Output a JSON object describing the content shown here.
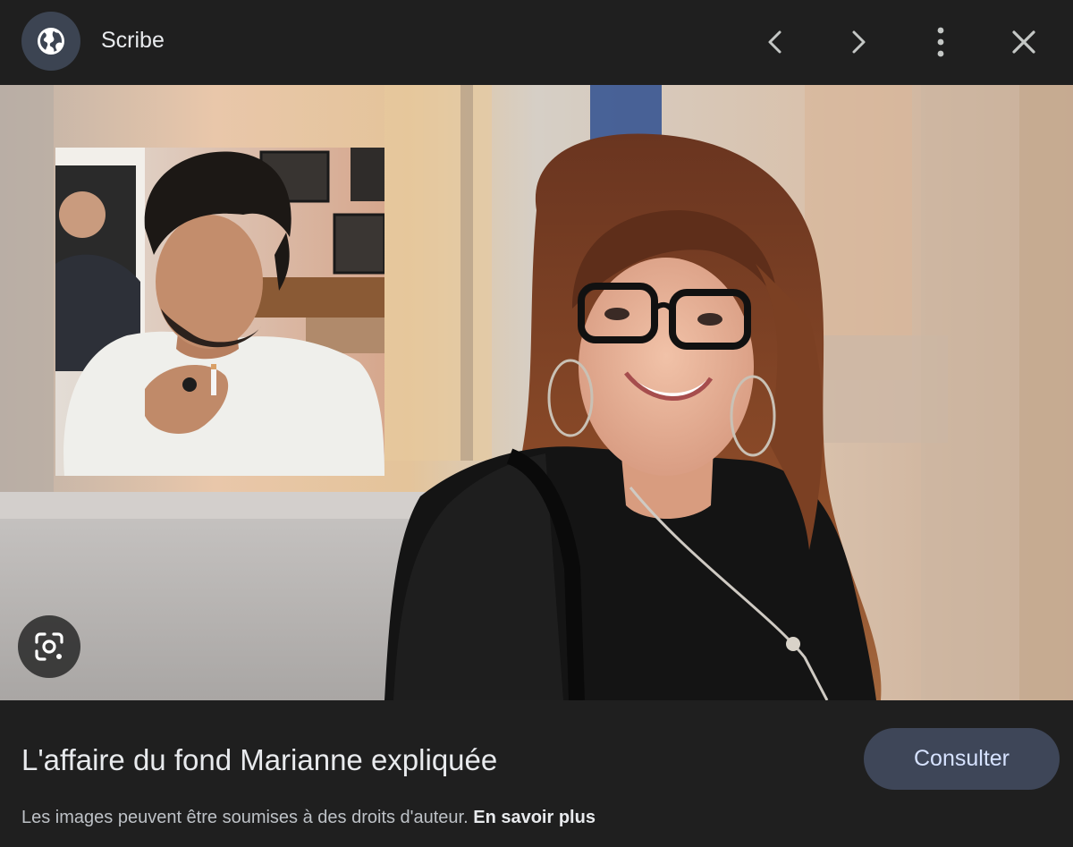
{
  "header": {
    "site_name": "Scribe",
    "site_icon": "globe-icon",
    "prev_icon": "chevron-left-icon",
    "next_icon": "chevron-right-icon",
    "more_icon": "more-vert-icon",
    "close_icon": "close-icon"
  },
  "image": {
    "lens_icon": "google-lens-icon"
  },
  "footer": {
    "title": "L'affaire du fond Marianne expliquée",
    "consult_label": "Consulter",
    "copyright_text": "Les images peuvent être soumises à des droits d'auteur.",
    "learn_more_label": "En savoir plus"
  },
  "colors": {
    "background": "#1f1f1f",
    "button_bg": "#3e4658",
    "button_text": "#d6e2ff",
    "icon_circle": "#3c4452"
  }
}
